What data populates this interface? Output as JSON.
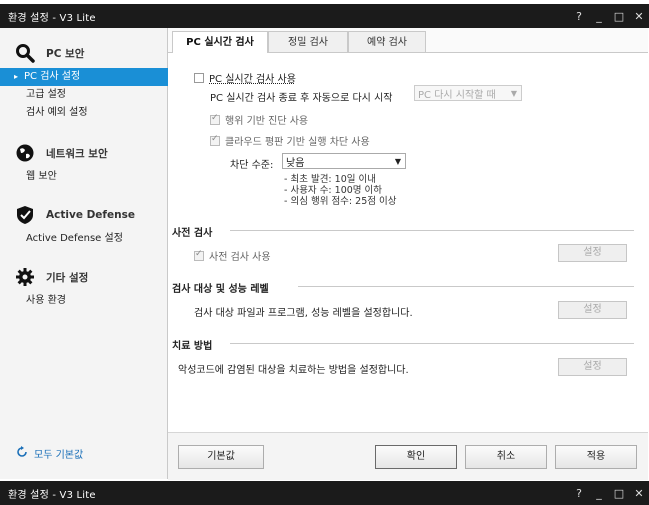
{
  "window": {
    "title": "환경 설정 - V3 Lite",
    "controls": [
      "?",
      "_",
      "□",
      "✕"
    ]
  },
  "sidebar": {
    "sections": [
      {
        "label": "PC 보안",
        "icon": "magnifier-icon",
        "items": [
          "PC 검사 설정",
          "고급 설정",
          "검사 예외 설정"
        ]
      },
      {
        "label": "네트워크 보안",
        "icon": "globe-icon",
        "items": [
          "웹 보안"
        ]
      },
      {
        "label": "Active Defense",
        "icon": "shield-check-icon",
        "items": [
          "Active Defense 설정"
        ]
      },
      {
        "label": "기타 설정",
        "icon": "gear-icon",
        "items": [
          "사용 환경"
        ]
      }
    ],
    "reset_label": "모두 기본값"
  },
  "tabs": [
    "PC 실시간 검사",
    "정밀 검사",
    "예약 검사"
  ],
  "realtime": {
    "enable_label": "PC 실시간 검사 사용",
    "restart_label": "PC 실시간 검사 종료 후 자동으로 다시 시작",
    "restart_dropdown": "PC 다시 시작할 때",
    "behavior_label": "행위 기반 진단 사용",
    "cloud_label": "클라우드 평판 기반 실행 차단 사용",
    "block_level_label": "차단 수준:",
    "block_level_value": "낮음",
    "notes": [
      "- 최초 발견: 10일 이내",
      "- 사용자 수: 100명 이하",
      "- 의심 행위 점수: 25점 이상"
    ]
  },
  "precheck": {
    "title": "사전 검사",
    "use_label": "사전 검사 사용",
    "button": "설정"
  },
  "performance": {
    "title": "검사 대상 및 성능 레벨",
    "desc": "검사 대상 파일과 프로그램, 성능 레벨을 설정합니다.",
    "button": "설정"
  },
  "treatment": {
    "title": "치료 방법",
    "desc": "악성코드에 감염된 대상을 치료하는 방법을 설정합니다.",
    "button": "설정"
  },
  "footer": {
    "default": "기본값",
    "ok": "확인",
    "cancel": "취소",
    "apply": "적용"
  }
}
